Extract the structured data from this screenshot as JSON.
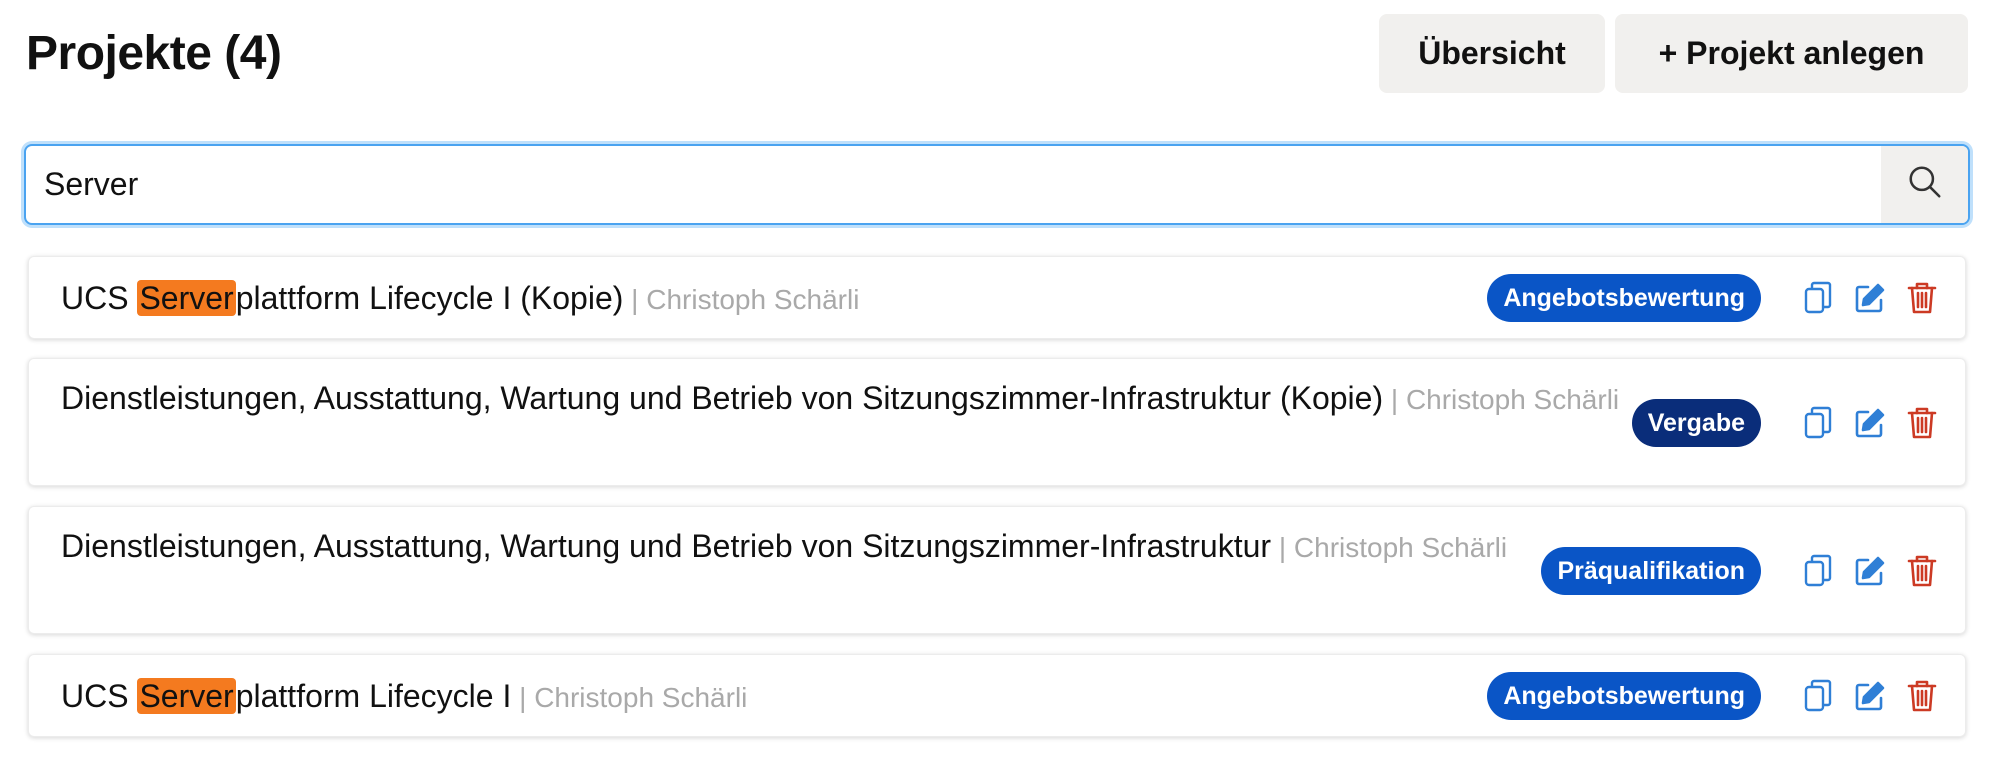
{
  "header": {
    "title": "Projekte (4)",
    "overview_label": "Übersicht",
    "new_project_label": "+ Projekt anlegen"
  },
  "search": {
    "value": "Server"
  },
  "colors": {
    "highlight": "#f47a1f",
    "badge_blue": "#0a55c6",
    "badge_dark_blue": "#0a2d7a",
    "icon_blue": "#2f7fd6",
    "icon_red": "#cc3a24"
  },
  "projects": [
    {
      "title_prefix": "UCS ",
      "title_match": "Server",
      "title_suffix": "plattform Lifecycle I (Kopie)",
      "owner": " | Christoph Schärli",
      "status": "Angebotsbewertung"
    },
    {
      "title_prefix": "Dienstleistungen, Ausstattung, Wartung und Betrieb von Sitzungszimmer-Infrastruktur (Kopie)",
      "title_match": "",
      "title_suffix": "",
      "owner": " | Christoph Schärli",
      "status": "Vergabe"
    },
    {
      "title_prefix": "Dienstleistungen, Ausstattung, Wartung und Betrieb von Sitzungszimmer-Infrastruktur",
      "title_match": "",
      "title_suffix": "",
      "owner": " | Christoph Schärli",
      "status": "Präqualifikation"
    },
    {
      "title_prefix": "UCS ",
      "title_match": "Server",
      "title_suffix": "plattform Lifecycle I",
      "owner": " | Christoph Schärli",
      "status": "Angebotsbewertung"
    }
  ],
  "icons": {
    "search": "search-icon",
    "copy": "copy-icon",
    "edit": "edit-icon",
    "delete": "trash-icon"
  }
}
